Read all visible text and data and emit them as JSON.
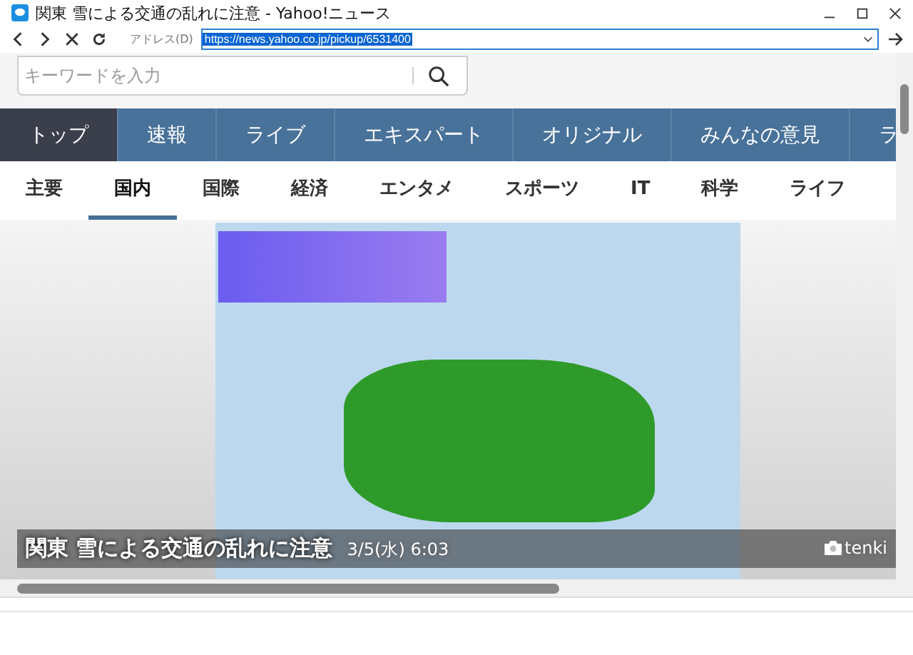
{
  "window": {
    "title": "関東 雪による交通の乱れに注意 - Yahoo!ニュース"
  },
  "toolbar": {
    "address_label": "アドレス(D)",
    "address": "https://news.yahoo.co.jp/pickup/6531400"
  },
  "search": {
    "placeholder": "キーワードを入力"
  },
  "main_nav": [
    {
      "label": "トップ",
      "selected": true
    },
    {
      "label": "速報",
      "selected": false
    },
    {
      "label": "ライブ",
      "selected": false
    },
    {
      "label": "エキスパート",
      "selected": false
    },
    {
      "label": "オリジナル",
      "selected": false
    },
    {
      "label": "みんなの意見",
      "selected": false
    },
    {
      "label": "ラ",
      "selected": false
    }
  ],
  "sub_nav": [
    {
      "label": "主要",
      "selected": false
    },
    {
      "label": "国内",
      "selected": true
    },
    {
      "label": "国際",
      "selected": false
    },
    {
      "label": "経済",
      "selected": false
    },
    {
      "label": "エンタメ",
      "selected": false
    },
    {
      "label": "スポーツ",
      "selected": false
    },
    {
      "label": "IT",
      "selected": false
    },
    {
      "label": "科学",
      "selected": false
    },
    {
      "label": "ライフ",
      "selected": false
    }
  ],
  "headline": {
    "title": "関東 雪による交通の乱れに注意",
    "time": "3/5(水) 6:03",
    "credit": "tenki"
  }
}
